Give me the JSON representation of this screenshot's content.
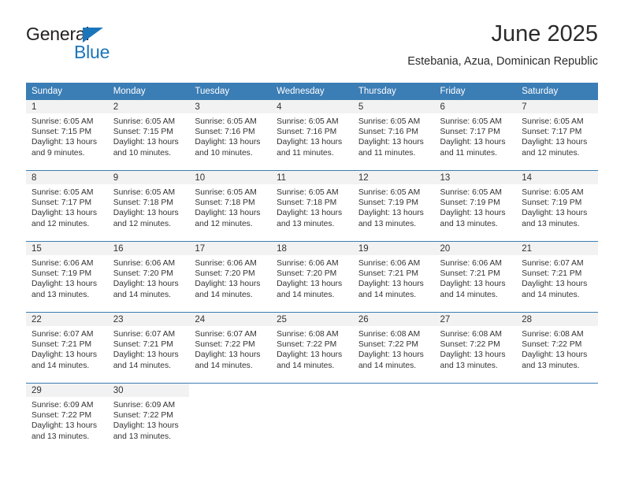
{
  "brand": {
    "name_part1": "General",
    "name_part2": "Blue",
    "triangle_color": "#1b75bb"
  },
  "header": {
    "title": "June 2025",
    "subtitle": "Estebania, Azua, Dominican Republic"
  },
  "theme": {
    "header_blue": "#3b7db5",
    "daynum_strip": "#f2f2f2",
    "text": "#333333"
  },
  "weekday_headers": [
    "Sunday",
    "Monday",
    "Tuesday",
    "Wednesday",
    "Thursday",
    "Friday",
    "Saturday"
  ],
  "weeks": [
    {
      "days": [
        {
          "num": "1",
          "sunrise": "Sunrise: 6:05 AM",
          "sunset": "Sunset: 7:15 PM",
          "daylight1": "Daylight: 13 hours",
          "daylight2": "and 9 minutes."
        },
        {
          "num": "2",
          "sunrise": "Sunrise: 6:05 AM",
          "sunset": "Sunset: 7:15 PM",
          "daylight1": "Daylight: 13 hours",
          "daylight2": "and 10 minutes."
        },
        {
          "num": "3",
          "sunrise": "Sunrise: 6:05 AM",
          "sunset": "Sunset: 7:16 PM",
          "daylight1": "Daylight: 13 hours",
          "daylight2": "and 10 minutes."
        },
        {
          "num": "4",
          "sunrise": "Sunrise: 6:05 AM",
          "sunset": "Sunset: 7:16 PM",
          "daylight1": "Daylight: 13 hours",
          "daylight2": "and 11 minutes."
        },
        {
          "num": "5",
          "sunrise": "Sunrise: 6:05 AM",
          "sunset": "Sunset: 7:16 PM",
          "daylight1": "Daylight: 13 hours",
          "daylight2": "and 11 minutes."
        },
        {
          "num": "6",
          "sunrise": "Sunrise: 6:05 AM",
          "sunset": "Sunset: 7:17 PM",
          "daylight1": "Daylight: 13 hours",
          "daylight2": "and 11 minutes."
        },
        {
          "num": "7",
          "sunrise": "Sunrise: 6:05 AM",
          "sunset": "Sunset: 7:17 PM",
          "daylight1": "Daylight: 13 hours",
          "daylight2": "and 12 minutes."
        }
      ]
    },
    {
      "days": [
        {
          "num": "8",
          "sunrise": "Sunrise: 6:05 AM",
          "sunset": "Sunset: 7:17 PM",
          "daylight1": "Daylight: 13 hours",
          "daylight2": "and 12 minutes."
        },
        {
          "num": "9",
          "sunrise": "Sunrise: 6:05 AM",
          "sunset": "Sunset: 7:18 PM",
          "daylight1": "Daylight: 13 hours",
          "daylight2": "and 12 minutes."
        },
        {
          "num": "10",
          "sunrise": "Sunrise: 6:05 AM",
          "sunset": "Sunset: 7:18 PM",
          "daylight1": "Daylight: 13 hours",
          "daylight2": "and 12 minutes."
        },
        {
          "num": "11",
          "sunrise": "Sunrise: 6:05 AM",
          "sunset": "Sunset: 7:18 PM",
          "daylight1": "Daylight: 13 hours",
          "daylight2": "and 13 minutes."
        },
        {
          "num": "12",
          "sunrise": "Sunrise: 6:05 AM",
          "sunset": "Sunset: 7:19 PM",
          "daylight1": "Daylight: 13 hours",
          "daylight2": "and 13 minutes."
        },
        {
          "num": "13",
          "sunrise": "Sunrise: 6:05 AM",
          "sunset": "Sunset: 7:19 PM",
          "daylight1": "Daylight: 13 hours",
          "daylight2": "and 13 minutes."
        },
        {
          "num": "14",
          "sunrise": "Sunrise: 6:05 AM",
          "sunset": "Sunset: 7:19 PM",
          "daylight1": "Daylight: 13 hours",
          "daylight2": "and 13 minutes."
        }
      ]
    },
    {
      "days": [
        {
          "num": "15",
          "sunrise": "Sunrise: 6:06 AM",
          "sunset": "Sunset: 7:19 PM",
          "daylight1": "Daylight: 13 hours",
          "daylight2": "and 13 minutes."
        },
        {
          "num": "16",
          "sunrise": "Sunrise: 6:06 AM",
          "sunset": "Sunset: 7:20 PM",
          "daylight1": "Daylight: 13 hours",
          "daylight2": "and 14 minutes."
        },
        {
          "num": "17",
          "sunrise": "Sunrise: 6:06 AM",
          "sunset": "Sunset: 7:20 PM",
          "daylight1": "Daylight: 13 hours",
          "daylight2": "and 14 minutes."
        },
        {
          "num": "18",
          "sunrise": "Sunrise: 6:06 AM",
          "sunset": "Sunset: 7:20 PM",
          "daylight1": "Daylight: 13 hours",
          "daylight2": "and 14 minutes."
        },
        {
          "num": "19",
          "sunrise": "Sunrise: 6:06 AM",
          "sunset": "Sunset: 7:21 PM",
          "daylight1": "Daylight: 13 hours",
          "daylight2": "and 14 minutes."
        },
        {
          "num": "20",
          "sunrise": "Sunrise: 6:06 AM",
          "sunset": "Sunset: 7:21 PM",
          "daylight1": "Daylight: 13 hours",
          "daylight2": "and 14 minutes."
        },
        {
          "num": "21",
          "sunrise": "Sunrise: 6:07 AM",
          "sunset": "Sunset: 7:21 PM",
          "daylight1": "Daylight: 13 hours",
          "daylight2": "and 14 minutes."
        }
      ]
    },
    {
      "days": [
        {
          "num": "22",
          "sunrise": "Sunrise: 6:07 AM",
          "sunset": "Sunset: 7:21 PM",
          "daylight1": "Daylight: 13 hours",
          "daylight2": "and 14 minutes."
        },
        {
          "num": "23",
          "sunrise": "Sunrise: 6:07 AM",
          "sunset": "Sunset: 7:21 PM",
          "daylight1": "Daylight: 13 hours",
          "daylight2": "and 14 minutes."
        },
        {
          "num": "24",
          "sunrise": "Sunrise: 6:07 AM",
          "sunset": "Sunset: 7:22 PM",
          "daylight1": "Daylight: 13 hours",
          "daylight2": "and 14 minutes."
        },
        {
          "num": "25",
          "sunrise": "Sunrise: 6:08 AM",
          "sunset": "Sunset: 7:22 PM",
          "daylight1": "Daylight: 13 hours",
          "daylight2": "and 14 minutes."
        },
        {
          "num": "26",
          "sunrise": "Sunrise: 6:08 AM",
          "sunset": "Sunset: 7:22 PM",
          "daylight1": "Daylight: 13 hours",
          "daylight2": "and 14 minutes."
        },
        {
          "num": "27",
          "sunrise": "Sunrise: 6:08 AM",
          "sunset": "Sunset: 7:22 PM",
          "daylight1": "Daylight: 13 hours",
          "daylight2": "and 13 minutes."
        },
        {
          "num": "28",
          "sunrise": "Sunrise: 6:08 AM",
          "sunset": "Sunset: 7:22 PM",
          "daylight1": "Daylight: 13 hours",
          "daylight2": "and 13 minutes."
        }
      ]
    },
    {
      "days": [
        {
          "num": "29",
          "sunrise": "Sunrise: 6:09 AM",
          "sunset": "Sunset: 7:22 PM",
          "daylight1": "Daylight: 13 hours",
          "daylight2": "and 13 minutes."
        },
        {
          "num": "30",
          "sunrise": "Sunrise: 6:09 AM",
          "sunset": "Sunset: 7:22 PM",
          "daylight1": "Daylight: 13 hours",
          "daylight2": "and 13 minutes."
        },
        {
          "num": "",
          "sunrise": "",
          "sunset": "",
          "daylight1": "",
          "daylight2": ""
        },
        {
          "num": "",
          "sunrise": "",
          "sunset": "",
          "daylight1": "",
          "daylight2": ""
        },
        {
          "num": "",
          "sunrise": "",
          "sunset": "",
          "daylight1": "",
          "daylight2": ""
        },
        {
          "num": "",
          "sunrise": "",
          "sunset": "",
          "daylight1": "",
          "daylight2": ""
        },
        {
          "num": "",
          "sunrise": "",
          "sunset": "",
          "daylight1": "",
          "daylight2": ""
        }
      ]
    }
  ]
}
